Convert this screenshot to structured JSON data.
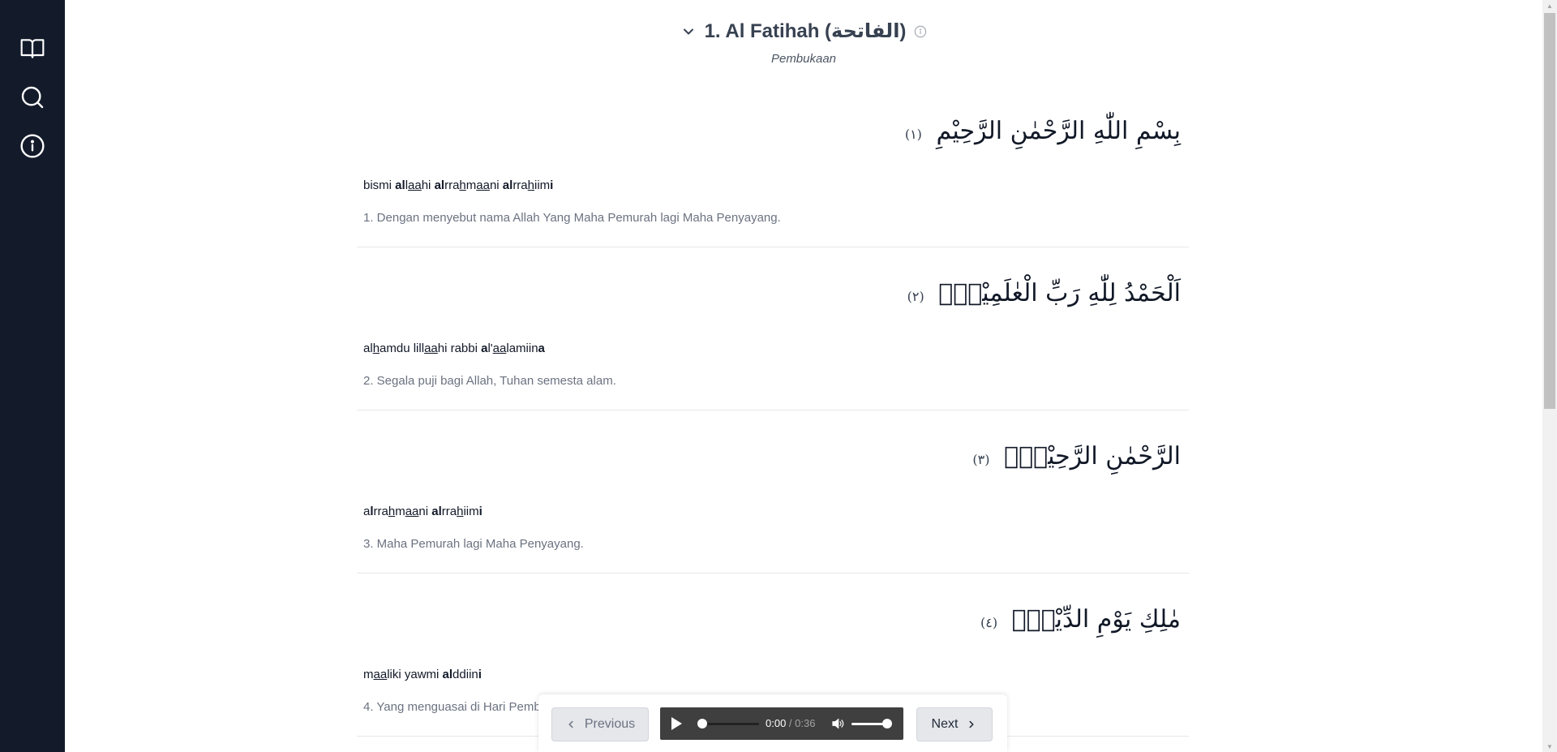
{
  "sidebar": {
    "items": [
      {
        "icon": "book-open-icon"
      },
      {
        "icon": "search-icon"
      },
      {
        "icon": "info-icon"
      }
    ]
  },
  "header": {
    "title": "1. Al Fatihah (الفاتحة)",
    "subtitle": "Pembukaan"
  },
  "ayahs": [
    {
      "arabic": "بِسْمِ اللّٰهِ الرَّحْمٰنِ الرَّحِيْمِ",
      "number": "(١)",
      "translation": "1. Dengan menyebut nama Allah Yang Maha Pemurah lagi Maha Penyayang."
    },
    {
      "arabic": "اَلْحَمْدُ لِلّٰهِ رَبِّ الْعٰلَمِيْنَۙ",
      "number": "(٢)",
      "translation": "2. Segala puji bagi Allah, Tuhan semesta alam."
    },
    {
      "arabic": "الرَّحْمٰنِ الرَّحِيْمِۙ",
      "number": "(٣)",
      "translation": "3. Maha Pemurah lagi Maha Penyayang."
    },
    {
      "arabic": "مٰلِكِ يَوْمِ الدِّيْنِۗ",
      "number": "(٤)",
      "translation": "4. Yang menguasai di Hari Pembalasan."
    }
  ],
  "transliterations": [
    [
      {
        "t": "bismi ",
        "b": false,
        "u": false
      },
      {
        "t": "al",
        "b": true,
        "u": false
      },
      {
        "t": "l",
        "b": false,
        "u": false
      },
      {
        "t": "aa",
        "b": false,
        "u": true
      },
      {
        "t": "hi ",
        "b": false,
        "u": false
      },
      {
        "t": "al",
        "b": true,
        "u": false
      },
      {
        "t": "rra",
        "b": false,
        "u": false
      },
      {
        "t": "h",
        "b": false,
        "u": true
      },
      {
        "t": "m",
        "b": false,
        "u": false
      },
      {
        "t": "aa",
        "b": false,
        "u": true
      },
      {
        "t": "ni ",
        "b": false,
        "u": false
      },
      {
        "t": "al",
        "b": true,
        "u": false
      },
      {
        "t": "rra",
        "b": false,
        "u": false
      },
      {
        "t": "h",
        "b": false,
        "u": true
      },
      {
        "t": "iim",
        "b": false,
        "u": false
      },
      {
        "t": "i",
        "b": true,
        "u": false
      }
    ],
    [
      {
        "t": "al",
        "b": false,
        "u": false
      },
      {
        "t": "h",
        "b": false,
        "u": true
      },
      {
        "t": "amdu lill",
        "b": false,
        "u": false
      },
      {
        "t": "aa",
        "b": false,
        "u": true
      },
      {
        "t": "hi rabbi ",
        "b": false,
        "u": false
      },
      {
        "t": "a",
        "b": true,
        "u": false
      },
      {
        "t": "l'",
        "b": false,
        "u": false
      },
      {
        "t": "aa",
        "b": false,
        "u": true
      },
      {
        "t": "lamiin",
        "b": false,
        "u": false
      },
      {
        "t": "a",
        "b": true,
        "u": false
      }
    ],
    [
      {
        "t": "a",
        "b": false,
        "u": false
      },
      {
        "t": "l",
        "b": true,
        "u": false
      },
      {
        "t": "rra",
        "b": false,
        "u": false
      },
      {
        "t": "h",
        "b": false,
        "u": true
      },
      {
        "t": "m",
        "b": false,
        "u": false
      },
      {
        "t": "aa",
        "b": false,
        "u": true
      },
      {
        "t": "ni ",
        "b": false,
        "u": false
      },
      {
        "t": "al",
        "b": true,
        "u": false
      },
      {
        "t": "rra",
        "b": false,
        "u": false
      },
      {
        "t": "h",
        "b": false,
        "u": true
      },
      {
        "t": "iim",
        "b": false,
        "u": false
      },
      {
        "t": "i",
        "b": true,
        "u": false
      }
    ],
    [
      {
        "t": "m",
        "b": false,
        "u": false
      },
      {
        "t": "aa",
        "b": false,
        "u": true
      },
      {
        "t": "liki yawmi ",
        "b": false,
        "u": false
      },
      {
        "t": "al",
        "b": true,
        "u": false
      },
      {
        "t": "ddiin",
        "b": false,
        "u": false
      },
      {
        "t": "i",
        "b": true,
        "u": false
      }
    ]
  ],
  "player": {
    "previous_label": "Previous",
    "next_label": "Next",
    "current_time": "0:00",
    "separator": " / ",
    "duration": "0:36",
    "progress": 0,
    "volume": 1
  },
  "colors": {
    "sidebar_bg": "#131b2b",
    "title": "#374151",
    "translation": "#6b7280",
    "player_bg": "#3f3f3f"
  }
}
